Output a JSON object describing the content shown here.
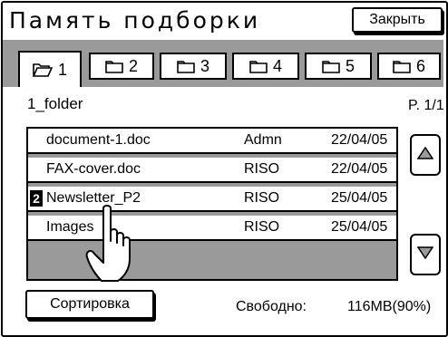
{
  "header": {
    "title": "Память подборки",
    "close_label": "Закрыть"
  },
  "tabs": [
    {
      "label": "1",
      "active": true
    },
    {
      "label": "2",
      "active": false
    },
    {
      "label": "3",
      "active": false
    },
    {
      "label": "4",
      "active": false
    },
    {
      "label": "5",
      "active": false
    },
    {
      "label": "6",
      "active": false
    }
  ],
  "folder": {
    "name": "1_folder",
    "page": "P. 1/1"
  },
  "files": [
    {
      "name": "document-1.doc",
      "owner": "Admn",
      "date": "22/04/05",
      "badge": ""
    },
    {
      "name": "FAX-cover.doc",
      "owner": "RISO",
      "date": "22/04/05",
      "badge": ""
    },
    {
      "name": "Newsletter_P2",
      "owner": "RISO",
      "date": "25/04/05",
      "badge": "2"
    },
    {
      "name": "Images",
      "owner": "RISO",
      "date": "25/04/05",
      "badge": ""
    }
  ],
  "footer": {
    "sort_label": "Сортировка",
    "free_label": "Свободно:",
    "free_value": "116MB(90%)"
  },
  "icons": {
    "folder": "folder-icon",
    "folder_open": "folder-open-icon",
    "scroll_up": "triangle-up-icon",
    "scroll_down": "triangle-down-icon",
    "pointer": "hand-pointer-icon"
  }
}
